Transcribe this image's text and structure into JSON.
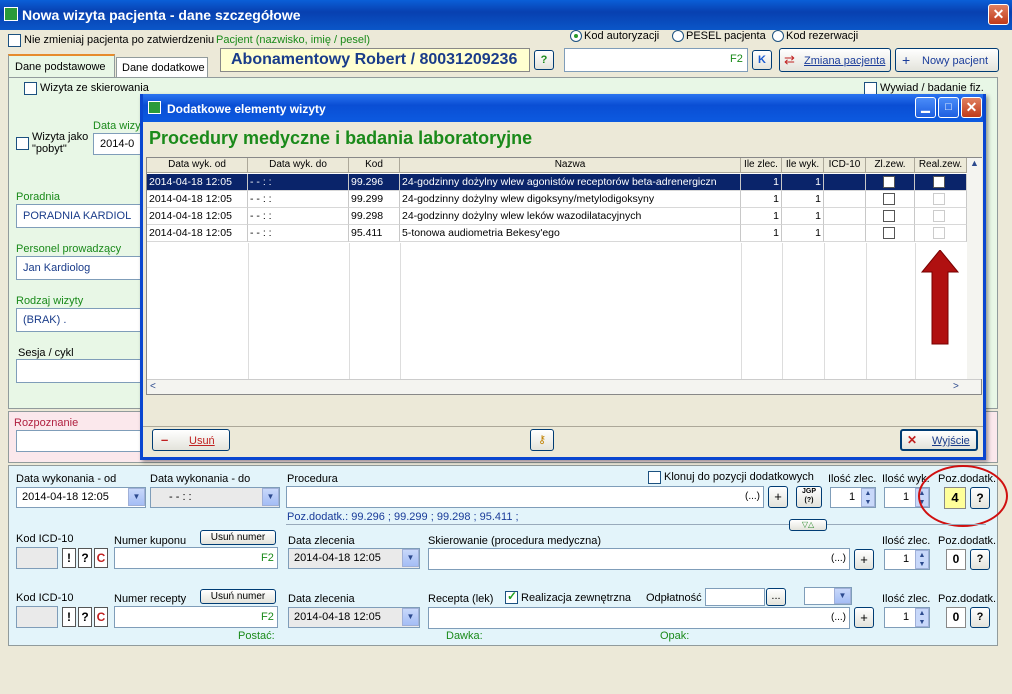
{
  "window": {
    "title": "Nowa wizyta pacjenta - dane szczegółowe",
    "close": "✕"
  },
  "header": {
    "no_change_label": "Nie zmieniaj pacjenta po zatwierdzeniu",
    "patient_caption": "Pacjent (nazwisko, imię / pesel)",
    "patient_name": "Abonamentowy Robert / 80031209236",
    "help": "?",
    "radio_auth": "Kod autoryzacji",
    "radio_pesel": "PESEL pacjenta",
    "radio_res": "Kod rezerwacji",
    "search_hint": "F2",
    "k_button": "K",
    "change_patient": "Zmiana pacjenta",
    "new_patient": "Nowy pacjent"
  },
  "tabs": [
    "Dane podstawowe",
    "Dane dodatkowe"
  ],
  "left": {
    "referral": "Wizyta ze skierowania",
    "visit_as": "Wizyta jako \"pobyt\"",
    "visit_date_label": "Data wizy",
    "visit_date": "2014-0",
    "clinic_label": "Poradnia",
    "clinic": "PORADNIA KARDIOL",
    "staff_label": "Personel prowadzący",
    "staff": "Jan Kardiolog",
    "visit_type_label": "Rodzaj wizyty",
    "visit_type": "(BRAK) .",
    "session_label": "Sesja / cykl",
    "diagnosis_label": "Rozpoznanie",
    "right_check": "Wywiad / badanie fiz."
  },
  "dialog": {
    "title": "Dodatkowe elementy wizyty",
    "heading": "Procedury medyczne i badania laboratoryjne",
    "columns": [
      "Data wyk. od",
      "Data wyk. do",
      "Kod",
      "Nazwa",
      "Ile zlec.",
      "Ile wyk.",
      "ICD-10",
      "Zl.zew.",
      "Real.zew."
    ],
    "rows": [
      {
        "od": "2014-04-18 12:05",
        "do": "- -   : :",
        "kod": "99.296",
        "nazwa": "24-godzinny dożylny wlew agonistów receptorów beta-adrenergiczn",
        "zlec": "1",
        "wyk": "1"
      },
      {
        "od": "2014-04-18 12:05",
        "do": "- -   : :",
        "kod": "99.299",
        "nazwa": "24-godzinny dożylny wlew digoksyny/metylodigoksyny",
        "zlec": "1",
        "wyk": "1"
      },
      {
        "od": "2014-04-18 12:05",
        "do": "- -   : :",
        "kod": "99.298",
        "nazwa": "24-godzinny dożylny wlew leków wazodilatacyjnych",
        "zlec": "1",
        "wyk": "1"
      },
      {
        "od": "2014-04-18 12:05",
        "do": "- -   : :",
        "kod": "95.411",
        "nazwa": "5-tonowa audiometria Bekesy'ego",
        "zlec": "1",
        "wyk": "1"
      }
    ],
    "delete": "Usuń",
    "exit": "Wyjście"
  },
  "procedure": {
    "date_from_label": "Data wykonania - od",
    "date_from": "2014-04-18 12:05",
    "date_to_label": "Data wykonania - do",
    "date_to": "- -   : :",
    "label": "Procedura",
    "clone": "Klonuj do pozycji dodatkowych",
    "ellipsis": "(...)",
    "plus": "+",
    "jgp": "JGP",
    "jgp_q": "(?)",
    "qty_ordered_label": "Ilość zlec.",
    "qty_ordered": "1",
    "qty_done_label": "Ilość wyk.",
    "qty_done": "1",
    "extra_label": "Poz.dodatk.",
    "extra": "4",
    "q": "?",
    "extra_list": "Poz.dodatk.:  99.296  ;  99.299  ;  99.298  ;  95.411  ;"
  },
  "referral_row": {
    "icd_label": "Kod ICD-10",
    "coupon_label": "Numer kuponu",
    "remove_number": "Usuń numer",
    "f2": "F2",
    "order_date_label": "Data zlecenia",
    "order_date": "2014-04-18 12:05",
    "ref_label": "Skierowanie (procedura medyczna)",
    "ellipsis": "(...)",
    "qty_label": "Ilość zlec.",
    "qty": "1",
    "extra_label": "Poz.dodatk.",
    "extra": "0",
    "excl": "!",
    "q": "?",
    "c": "C"
  },
  "recipe_row": {
    "icd_label": "Kod ICD-10",
    "recipe_label": "Numer recepty",
    "remove_number": "Usuń numer",
    "f2": "F2",
    "order_date_label": "Data zlecenia",
    "order_date": "2014-04-18 12:05",
    "drug_label": "Recepta (lek)",
    "external": "Realizacja zewnętrzna",
    "payment_label": "Odpłatność",
    "dots": "...",
    "ellipsis": "(...)",
    "qty_label": "Ilość zlec.",
    "qty": "1",
    "extra_label": "Poz.dodatk.",
    "extra": "0",
    "form_label": "Postać:",
    "dose_label": "Dawka:",
    "pack_label": "Opak:",
    "excl": "!",
    "q": "?",
    "c": "C"
  },
  "colors": {
    "accent_green": "#1a8a1a",
    "selection": "#0a246a",
    "arrow": "#b01010",
    "highlight": "#ffff9a",
    "circle": "#d01010"
  }
}
